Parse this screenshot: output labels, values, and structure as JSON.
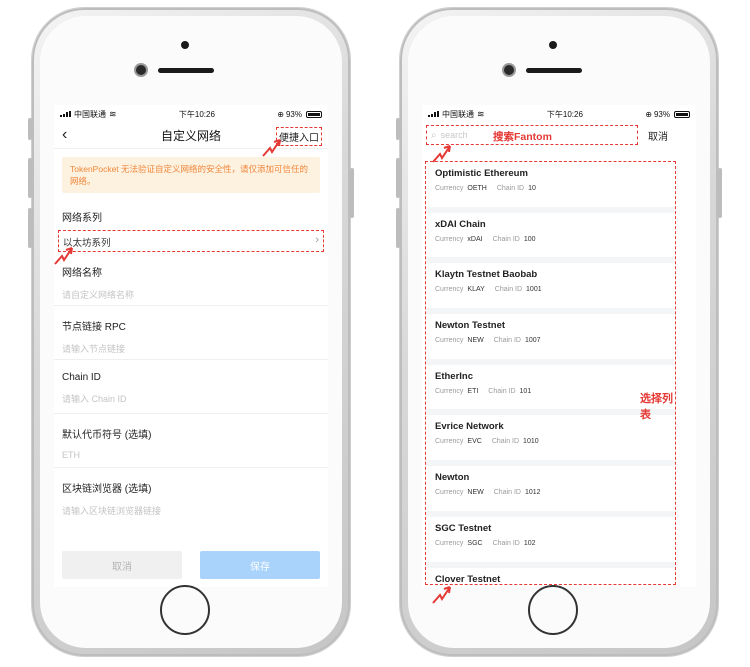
{
  "left_phone": {
    "status": {
      "carrier": "中国联通",
      "time": "下午10:26",
      "battery": "93%"
    },
    "nav": {
      "back_icon": "chevron-left-icon",
      "title": "自定义网络",
      "quick_entry": "便捷入口"
    },
    "warning": "TokenPocket 无法验证自定义网络的安全性，请仅添加可信任的网络。",
    "series": {
      "label": "网络系列",
      "value": "以太坊系列"
    },
    "fields": [
      {
        "label": "网络名称",
        "placeholder": "请自定义网络名称"
      },
      {
        "label": "节点链接 RPC",
        "placeholder": "请输入节点链接"
      },
      {
        "label": "Chain ID",
        "placeholder": "请输入 Chain ID"
      },
      {
        "label": "默认代币符号 (选填)",
        "placeholder": "ETH"
      },
      {
        "label": "区块链浏览器 (选填)",
        "placeholder": "请输入区块链浏览器链接"
      }
    ],
    "buttons": {
      "cancel": "取消",
      "save": "保存"
    }
  },
  "right_phone": {
    "status": {
      "carrier": "中国联通",
      "time": "下午10:26",
      "battery": "93%"
    },
    "search": {
      "placeholder": "search",
      "annotation": "搜索Fantom",
      "cancel": "取消"
    },
    "list_annotation": "选择列表",
    "labels": {
      "currency": "Currency",
      "chain_id": "Chain ID"
    },
    "networks": [
      {
        "name": "Optimistic Ethereum",
        "currency": "OETH",
        "chain_id": "10"
      },
      {
        "name": "xDAI Chain",
        "currency": "xDAI",
        "chain_id": "100"
      },
      {
        "name": "Klaytn Testnet Baobab",
        "currency": "KLAY",
        "chain_id": "1001"
      },
      {
        "name": "Newton Testnet",
        "currency": "NEW",
        "chain_id": "1007"
      },
      {
        "name": "EtherInc",
        "currency": "ETI",
        "chain_id": "101"
      },
      {
        "name": "Evrice Network",
        "currency": "EVC",
        "chain_id": "1010"
      },
      {
        "name": "Newton",
        "currency": "NEW",
        "chain_id": "1012"
      },
      {
        "name": "SGC Testnet",
        "currency": "SGC",
        "chain_id": "102"
      },
      {
        "name": "Clover Testnet",
        "currency": "",
        "chain_id": ""
      }
    ]
  },
  "colors": {
    "annotation": "#e53935",
    "warning_text": "#f0883a",
    "warning_bg": "#fdf1e0",
    "save_button": "#a9d3fb"
  }
}
